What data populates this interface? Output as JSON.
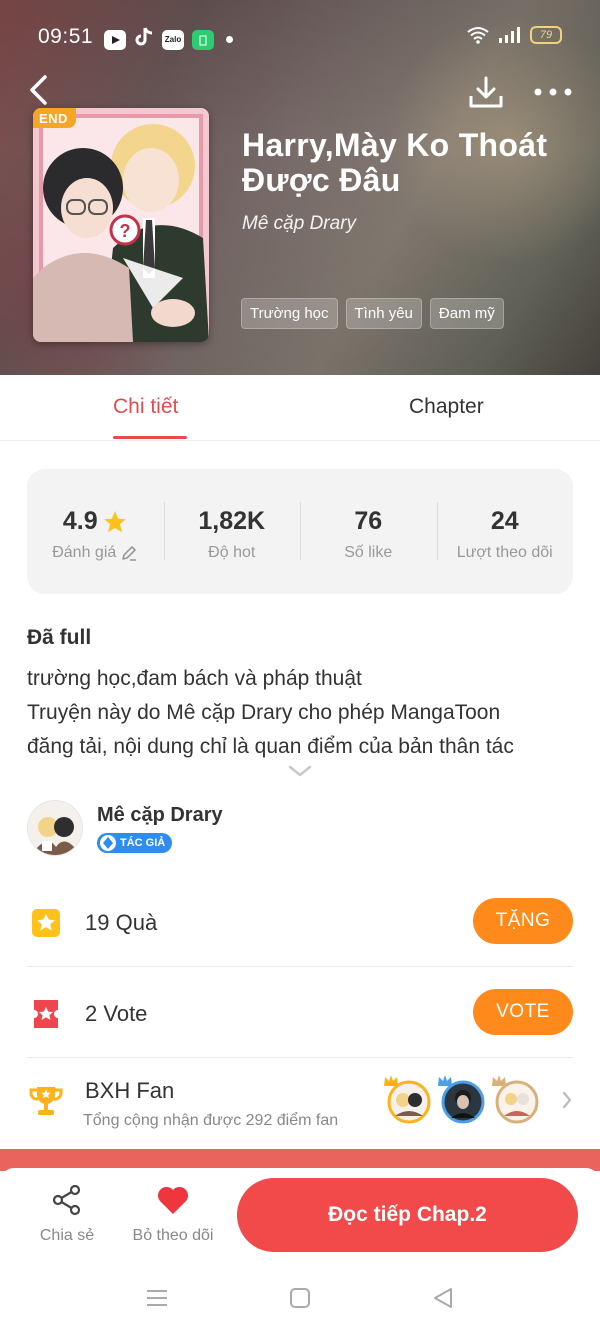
{
  "status_bar": {
    "time": "09:51",
    "app_icons": [
      "youtube-icon",
      "tiktok-icon",
      "zalo-icon",
      "battery-app-icon"
    ],
    "zalo_label": "Zalo",
    "battery": "79"
  },
  "header": {
    "end_badge": "END",
    "title": "Harry,Mày Ko Thoát Được Đâu",
    "author": "Mê cặp Drary",
    "genres": [
      "Trường học",
      "Tình yêu",
      "Đam mỹ"
    ]
  },
  "tabs": {
    "detail": "Chi tiết",
    "chapter": "Chapter",
    "active": "detail",
    "accent_color": "#e74c4c"
  },
  "stats": [
    {
      "value": "4.9",
      "label": "Đánh giá"
    },
    {
      "value": "1,82K",
      "label": "Độ hot"
    },
    {
      "value": "76",
      "label": "Số like"
    },
    {
      "value": "24",
      "label": "Lượt theo dõi"
    }
  ],
  "description": {
    "status": "Đã full",
    "lines": [
      "trường học,đam bách và pháp thuật",
      "Truyện này do Mê cặp Drary cho phép MangaToon",
      "đăng tải, nội dung chỉ là quan điểm của bản thân tác"
    ]
  },
  "author": {
    "name": "Mê cặp Drary",
    "badge": "TÁC GIẢ"
  },
  "gift": {
    "count": "19",
    "label": "Quà",
    "button": "TẶNG"
  },
  "vote": {
    "count": "2",
    "label": "Vote",
    "button": "VOTE"
  },
  "fan_ranking": {
    "title": "BXH Fan",
    "subtitle": "Tổng cộng nhận được 292 điểm fan"
  },
  "bottom_bar": {
    "share": "Chia sẻ",
    "unfollow": "Bỏ theo dõi",
    "read_button": "Đọc tiếp Chap.2",
    "primary_color": "#f24a4a",
    "secondary_color": "#ff8a1c"
  }
}
